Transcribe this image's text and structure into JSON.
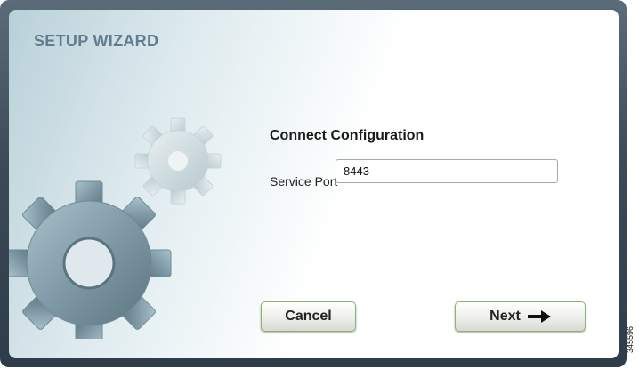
{
  "wizard": {
    "title": "SETUP WIZARD"
  },
  "form": {
    "heading": "Connect Configuration",
    "service_port_label": "Service Port",
    "service_port_value": "8443"
  },
  "buttons": {
    "cancel_label": "Cancel",
    "next_label": "Next"
  },
  "figure_code": "345596",
  "icons": {
    "illustration": "gears-icon",
    "next_arrow": "arrow-right-icon"
  },
  "colors": {
    "frame": "#3c4a57",
    "title": "#5f7d8e",
    "button_border": "#8fb36b"
  }
}
